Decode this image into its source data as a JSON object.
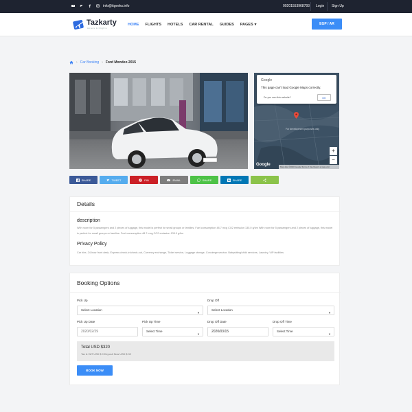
{
  "topbar": {
    "email": "info@itgeeks.info",
    "phone": "00201553968793",
    "login": "Login",
    "signup": "Sign Up",
    "social_icons": [
      "youtube-icon",
      "twitter-icon",
      "facebook-icon",
      "instagram-icon"
    ]
  },
  "header": {
    "logo_text": "Tazkarty",
    "logo_sub": "Hotels & Flights",
    "nav": [
      {
        "label": "HOME",
        "active": true
      },
      {
        "label": "FLIGHTS",
        "active": false
      },
      {
        "label": "HOTELS",
        "active": false
      },
      {
        "label": "CAR RENTAL",
        "active": false
      },
      {
        "label": "GUIDES",
        "active": false
      },
      {
        "label": "PAGES",
        "active": false
      }
    ],
    "lang_button": "EGP / AR"
  },
  "breadcrumb": {
    "link": "Car Booking",
    "current": "Ford Mondeo 2015"
  },
  "map": {
    "google_label": "Google",
    "error_message": "This page can't load Google Maps correctly.",
    "own_site_question": "Do you own this website?",
    "ok_label": "OK",
    "watermark": "Google",
    "footer": "Map data ©2020 Google   Terms of Use   Report a map error",
    "place_label": "For development purposes only",
    "zoom_in": "+",
    "zoom_out": "−"
  },
  "share": [
    {
      "label": "SHARE",
      "icon": "facebook-icon",
      "color": "#3b5998"
    },
    {
      "label": "TWEET",
      "icon": "twitter-icon",
      "color": "#55acee"
    },
    {
      "label": "PIN",
      "icon": "pinterest-icon",
      "color": "#cb2027"
    },
    {
      "label": "EMAIL",
      "icon": "email-icon",
      "color": "#7d7d7d"
    },
    {
      "label": "SHARE",
      "icon": "whatsapp-icon",
      "color": "#4dc247"
    },
    {
      "label": "SHARE",
      "icon": "linkedin-icon",
      "color": "#0077b5"
    },
    {
      "label": "",
      "icon": "share-icon",
      "color": "#8bc34a"
    }
  ],
  "details": {
    "title": "Details",
    "description_title": "description",
    "description_text": "With room for 5 passengers and 2 pieces of luggage, this model is perfect for small groups or families. Fuel consumption 48.7 mcg CO2 emission 135.0 g/km With room for 5 passengers and 2 pieces of luggage, this model is perfect for small groups or families. Fuel consumption 48.7 mcg CO2 emission 135.0 g/km",
    "policy_title": "Privacy Policy",
    "policy_text": "Car hire, 24-hour front desk, Express check-in/check-out, Currency exchange, Ticket service, Luggage storage, Concierge service, Babysitting/child services, Laundry, VIP facilities"
  },
  "booking": {
    "title": "Booking Options",
    "pickup_label": "Pick Up",
    "pickup_value": "Select Location",
    "dropoff_label": "Drop Off",
    "dropoff_value": "Select Location",
    "pickup_date_label": "Pick Up Date",
    "pickup_date_value": "2020/02/29",
    "pickup_time_label": "Pick Up Time",
    "pickup_time_value": "Select Time",
    "dropoff_date_label": "Drop Off Date",
    "dropoff_date_value": "2020/03/15",
    "dropoff_time_label": "Drop Off Time",
    "dropoff_time_value": "Select Time",
    "total": "Total USD $320",
    "total_sub": "Tax & VAT USD $ 0  Deposit Now USD $ 32",
    "book_now": "BOOK NOW"
  },
  "colors": {
    "accent": "#3b8df7",
    "topbar": "#1e2330"
  }
}
